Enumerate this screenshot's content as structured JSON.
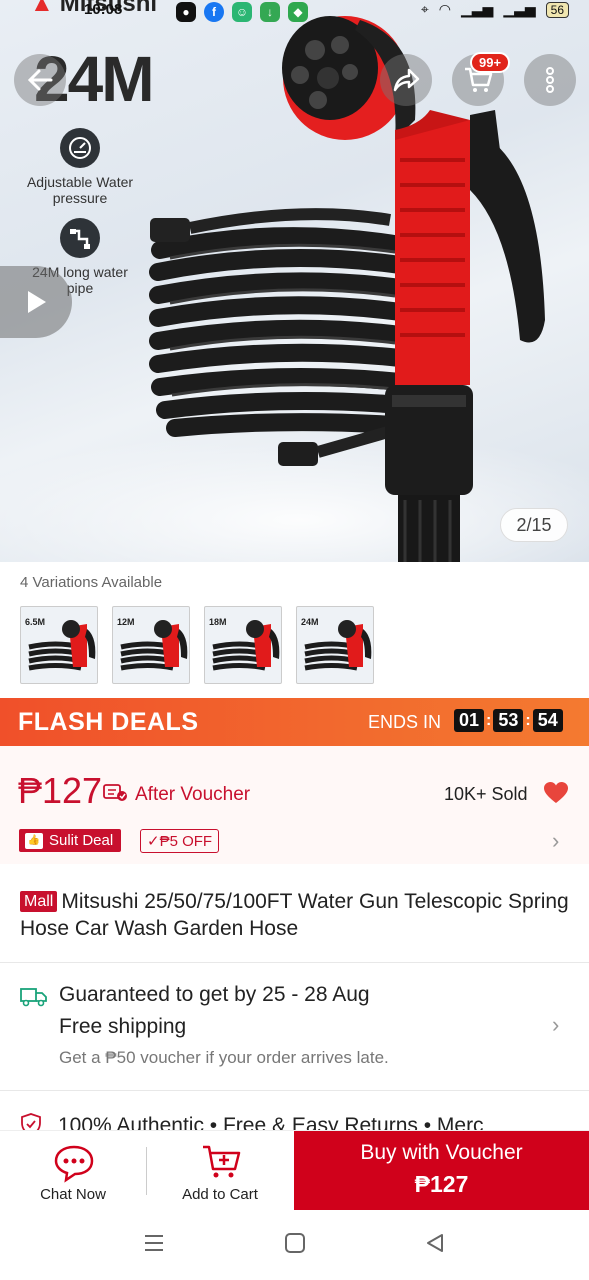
{
  "status_bar": {
    "time": "10:08",
    "battery": "56"
  },
  "hero": {
    "brand": "Mitsushi",
    "size_text": "24M",
    "cart_badge": "99+",
    "features": [
      {
        "label": "Adjustable Water pressure",
        "icon": "pressure-gauge-icon"
      },
      {
        "label": "24M long water pipe",
        "icon": "pipe-icon"
      }
    ],
    "page_counter": "2/15"
  },
  "variations": {
    "label": "4 Variations Available",
    "items": [
      "6.5M",
      "12M",
      "18M",
      "24M"
    ]
  },
  "flash_deals": {
    "title": "FLASH DEALS",
    "ends_in": "ENDS IN",
    "hours": "01",
    "minutes": "53",
    "seconds": "54"
  },
  "price": {
    "amount": "₱127",
    "after_voucher": "After Voucher",
    "sold": "10K+ Sold",
    "sulit_deal": "Sulit Deal",
    "off_tag": "₱5 OFF"
  },
  "product": {
    "mall_badge": "Mall",
    "title": "Mitsushi 25/50/75/100FT Water Gun Telescopic Spring Hose Car Wash Garden Hose"
  },
  "shipping": {
    "guarantee": "Guaranteed to get by 25 - 28 Aug",
    "free": "Free shipping",
    "note": "Get a ₱50 voucher if your order arrives late."
  },
  "assurance": {
    "text": "100% Authentic  •  Free & Easy Returns  •  Merc"
  },
  "bottom_bar": {
    "chat": "Chat Now",
    "add_to_cart": "Add to Cart",
    "buy_line1": "Buy with Voucher",
    "buy_line2": "₱127"
  },
  "colors": {
    "accent": "#d0011b",
    "flash_orange": "#f0502a",
    "price_red": "#c8102e"
  }
}
